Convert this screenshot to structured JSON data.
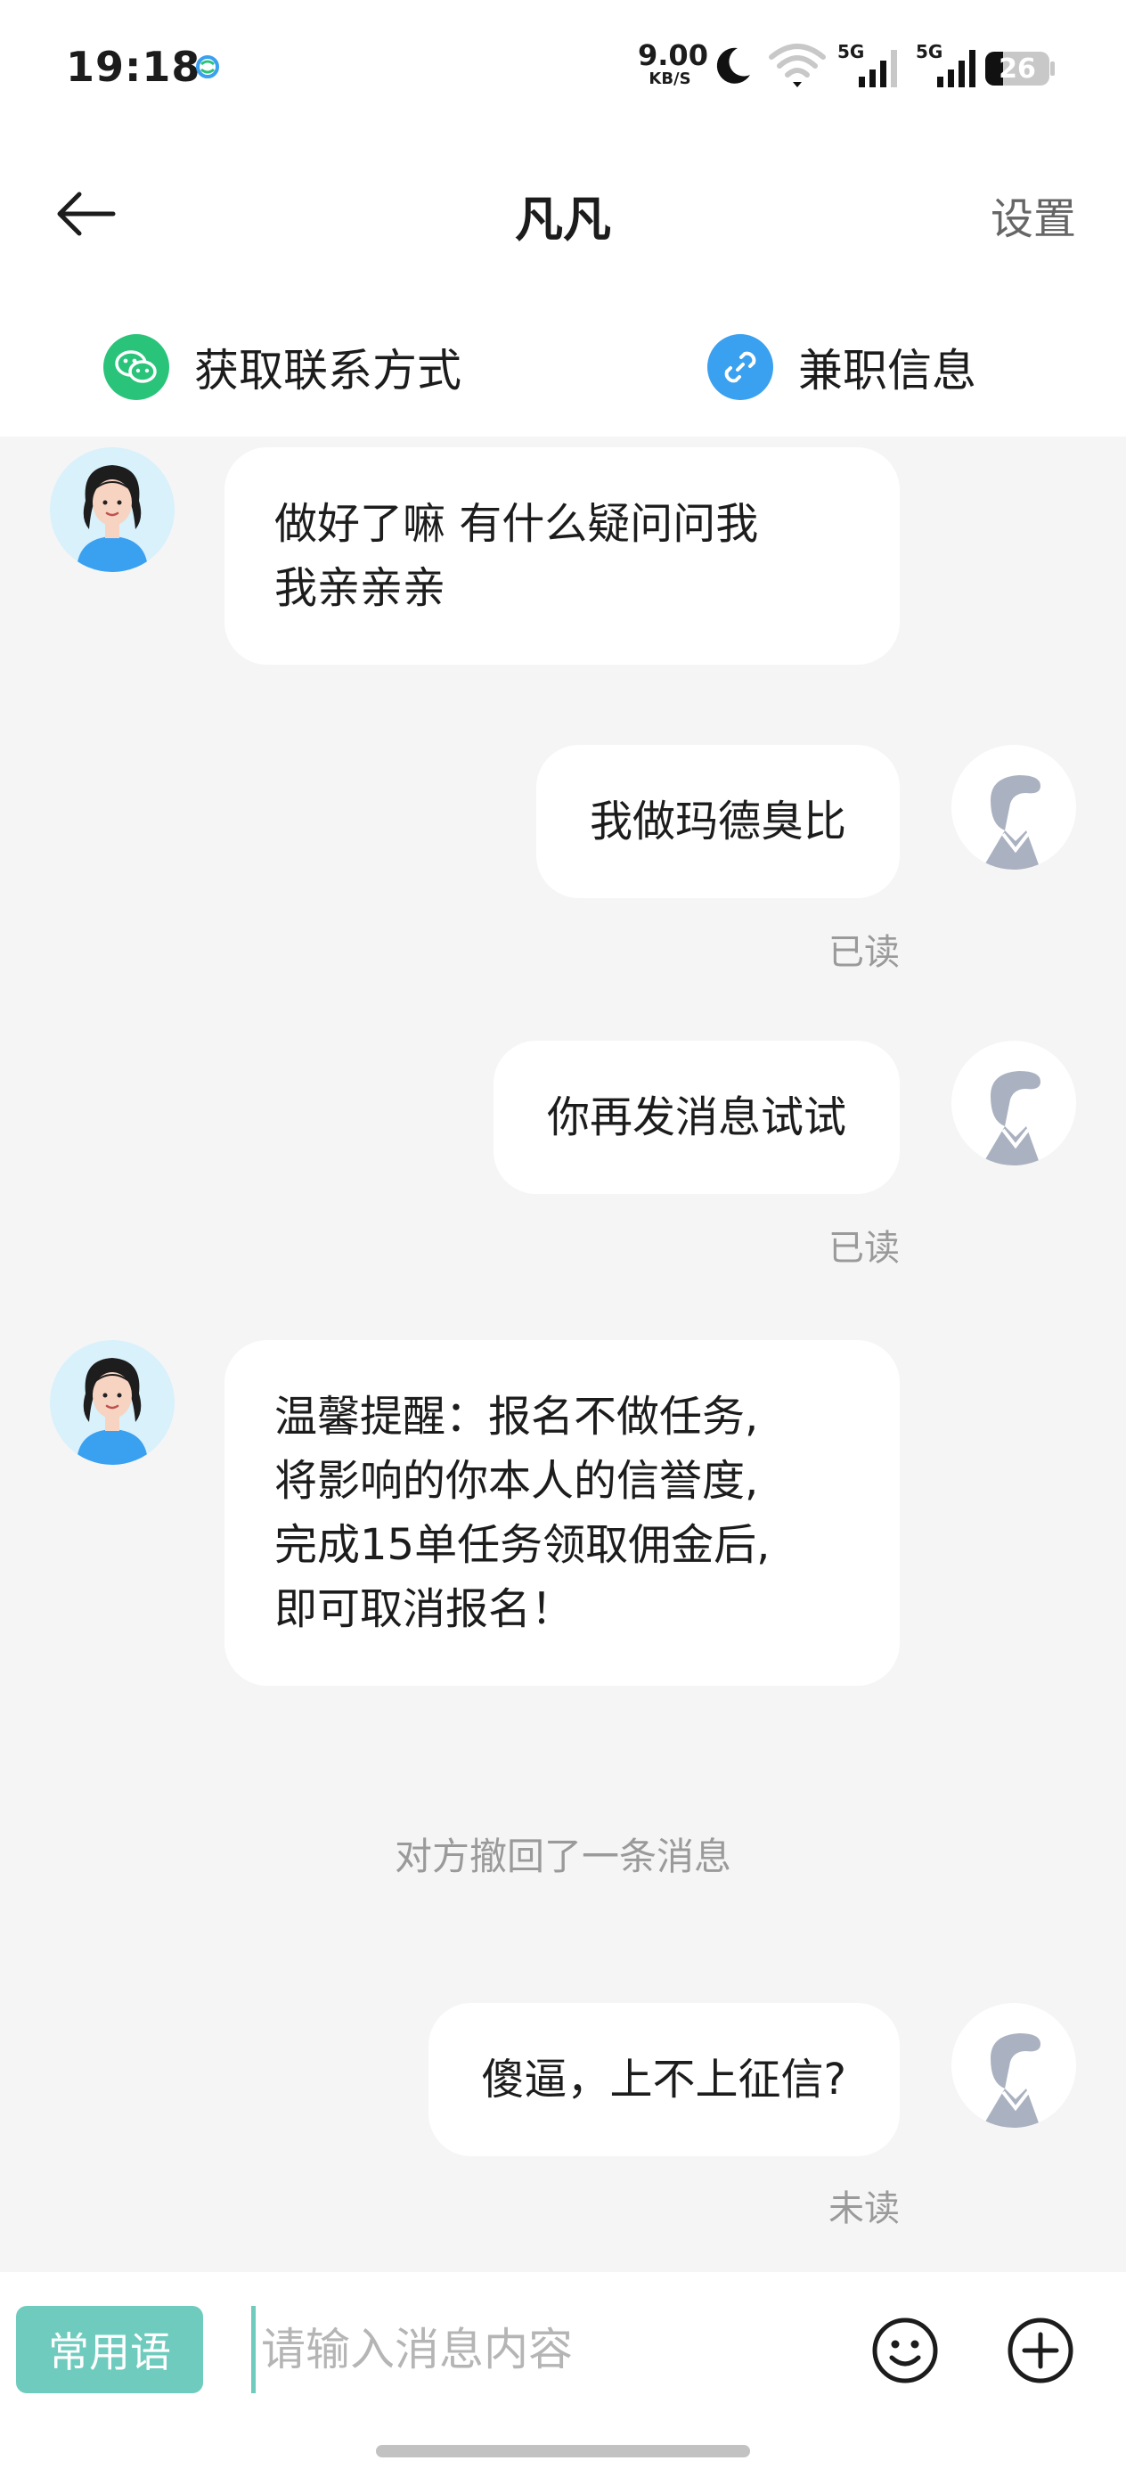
{
  "status_bar": {
    "time": "19:18",
    "net_speed": "9.00",
    "net_speed_unit": "KB/S",
    "battery": "26",
    "signal_label_1": "5G",
    "signal_label_2": "5G"
  },
  "header": {
    "title": "凡凡",
    "settings_label": "设置"
  },
  "quick_actions": {
    "contact_label": "获取联系方式",
    "jobs_label": "兼职信息"
  },
  "messages": [
    {
      "side": "left",
      "text": "做好了嘛 有什么疑问问我\n我亲亲亲"
    },
    {
      "side": "right",
      "text": "我做玛德臭比",
      "status": "已读"
    },
    {
      "side": "right",
      "text": "你再发消息试试",
      "status": "已读"
    },
    {
      "side": "left",
      "text": "温馨提醒：报名不做任务,\n将影响的你本人的信誉度,\n完成15单任务领取佣金后,\n即可取消报名！"
    },
    {
      "side": "system",
      "text": "对方撤回了一条消息"
    },
    {
      "side": "right",
      "text": "傻逼，上不上征信?",
      "status": "未读"
    }
  ],
  "input": {
    "phrases_label": "常用语",
    "placeholder": "请输入消息内容"
  },
  "colors": {
    "accent": "#6ecbbd",
    "wechat_green": "#29c37a",
    "link_blue": "#3aa0f0",
    "chat_bg": "#f5f5f5",
    "muted_text": "#9a9a9a"
  },
  "icons": {
    "back": "arrow-left-icon",
    "contact": "wechat-icon",
    "jobs": "link-icon",
    "emoji": "smiley-icon",
    "more": "plus-circle-icon"
  }
}
